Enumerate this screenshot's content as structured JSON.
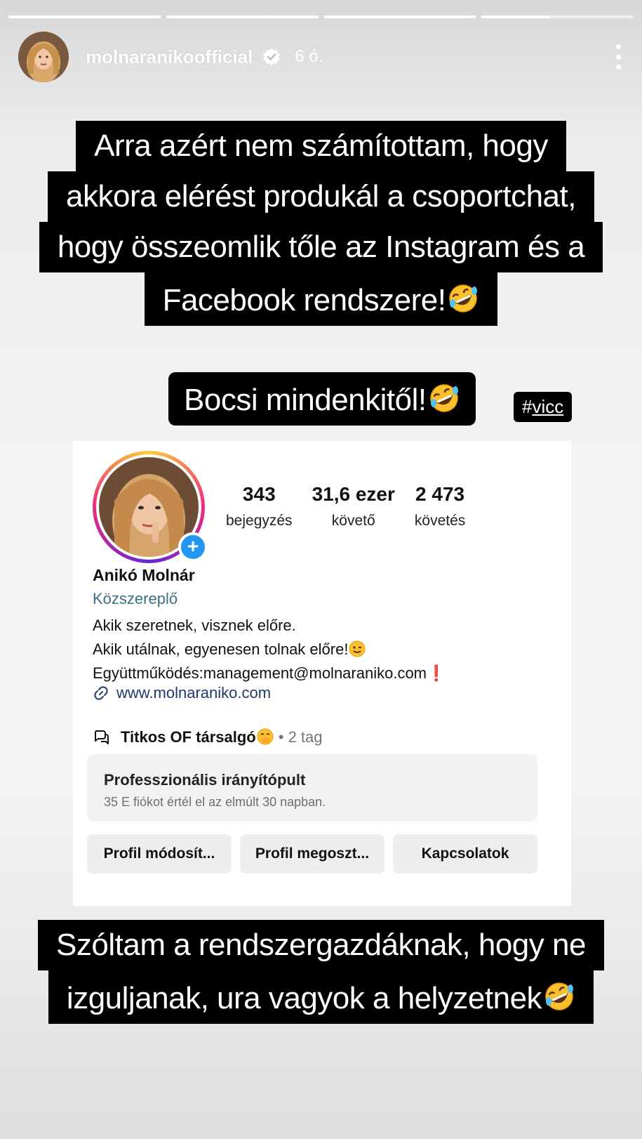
{
  "story": {
    "progress_segments": 4,
    "current_segment": 4,
    "current_segment_progress": 0.45
  },
  "header": {
    "username": "molnaranikoofficial",
    "time": "6 ó.",
    "verified_icon": "verified-badge-icon",
    "more_icon": "more-vertical-icon"
  },
  "captions": {
    "top_lines": [
      "Arra azért nem számítottam, hogy",
      "akkora elérést produkál a csoportchat,",
      "hogy összeomlik tőle az Instagram és a",
      "Facebook rendszere!"
    ],
    "middle": "Bocsi mindenkitől!",
    "hashtag_prefix": "#",
    "hashtag_word": "vicc",
    "bottom_lines": [
      "Szóltam a rendszergazdáknak, hogy ne",
      "izguljanak, ura vagyok a helyzetnek"
    ],
    "emoji": "rolling-on-floor-laughing-emoji"
  },
  "profile": {
    "stats": [
      {
        "value": "343",
        "label": "bejegyzés"
      },
      {
        "value": "31,6 ezer",
        "label": "követő"
      },
      {
        "value": "2 473",
        "label": "követés"
      }
    ],
    "name": "Anikó Molnár",
    "category": "Közszereplő",
    "bio_line1": "Akik szeretnek, visznek előre.",
    "bio_line2": "Akik utálnak, egyenesen tolnak előre!",
    "bio_line3": "Együttműködés:management@molnaraniko.com",
    "bio_line3_mark": "❗",
    "website": "www.molnaraniko.com",
    "group_name": "Titkos OF társalgó",
    "group_meta": "• 2 tag",
    "dashboard_title": "Professzionális irányítópult",
    "dashboard_sub": "35 E fiókot értél el az elmúlt 30 napban.",
    "buttons": [
      "Profil módosít...",
      "Profil megoszt...",
      "Kapcsolatok"
    ],
    "colors": {
      "category": "#3d6f84",
      "link": "#1f3a6b",
      "plus_badge": "#2196f3"
    }
  }
}
